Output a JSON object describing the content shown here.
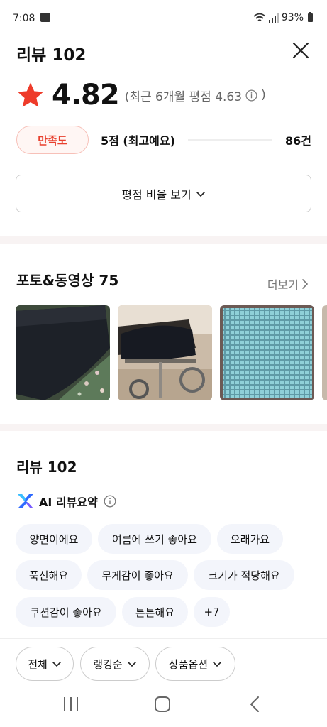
{
  "status": {
    "time": "7:08",
    "battery": "93%",
    "icons": [
      "image-icon",
      "wifi-icon",
      "signal-icon",
      "battery-icon"
    ]
  },
  "header": {
    "title": "리뷰 102",
    "close_icon": "close-icon"
  },
  "rating": {
    "value": "4.82",
    "recent_text": "(최근 6개월 평점 4.63",
    "recent_close": ")",
    "star_color": "#ee3b2a"
  },
  "satisfaction": {
    "badge": "만족도",
    "label": "5점 (최고예요)",
    "count": "86건",
    "accent": "#e8402e"
  },
  "ratio_button": {
    "label": "평점 비율 보기"
  },
  "photos": {
    "title": "포토&동영상 75",
    "more": "더보기"
  },
  "reviews": {
    "title": "리뷰 102",
    "ai_label": "AI 리뷰요약"
  },
  "keywords": [
    "양면이에요",
    "여름에 쓰기 좋아요",
    "오래가요",
    "푹신해요",
    "무게감이 좋아요",
    "크기가 적당해요",
    "쿠션감이 좋아요",
    "튼튼해요",
    "+7"
  ],
  "filters": [
    "전체",
    "랭킹순",
    "상품옵션"
  ]
}
